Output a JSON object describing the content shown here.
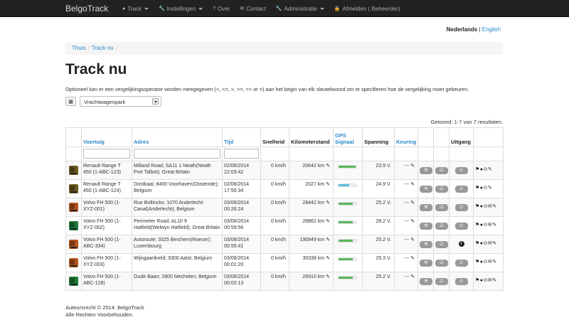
{
  "navbar": {
    "brand": "BelgoTrack",
    "items": [
      {
        "icon": "map-marker-icon",
        "glyph": "●",
        "label": "Track",
        "dropdown": true
      },
      {
        "icon": "wrench-icon",
        "glyph": "🔧",
        "label": "Instellingen",
        "dropdown": true
      },
      {
        "icon": "question-icon",
        "glyph": "?",
        "label": "Over",
        "dropdown": false
      },
      {
        "icon": "envelope-icon",
        "glyph": "✉",
        "label": "Contact",
        "dropdown": false
      },
      {
        "icon": "wrench-icon",
        "glyph": "🔧",
        "label": "Administratie",
        "dropdown": true
      },
      {
        "icon": "lock-icon",
        "glyph": "🔒",
        "label": "Afmelden ( Beheerder)",
        "dropdown": false
      }
    ]
  },
  "language": {
    "current": "Nederlands",
    "separator": "|",
    "other": "English"
  },
  "breadcrumb": [
    "Thuis",
    "Track nu"
  ],
  "page_title": "Track nu",
  "intro": "Optioneel kan er een vergelijkingsoperator worden meegegeven (<, <=, >, >=, <> or =) aan het begin van elk sleutelwoord om te specifieren hoe de vergelijking moet gebeuren.",
  "filter_select": {
    "value": "Vrachtwagenpark"
  },
  "result_count": "Getoond: 1-7 van 7 resultaten.",
  "table": {
    "headers": [
      "",
      "Voertuig",
      "Adres",
      "Tijd",
      "Snelheid",
      "Kilometerstand",
      "GPS Signaal",
      "Spanning",
      "Keuring",
      "",
      "",
      "Uitgang",
      ""
    ],
    "rows": [
      {
        "truck_color": "#6b5a1e",
        "vehicle": "Renault Range T 450 (1-ABC-123)",
        "address": "Milland Road; SA11 1 Neath(Neath Port Talbot); Great Britain",
        "time": "02/06/2014 22:03:42",
        "speed": "0 km/h",
        "km": "20642 km",
        "gps": 0.95,
        "gps_color": "#5cb85c",
        "voltage": "23.9 V.",
        "inspection": "---",
        "exit": "power",
        "actions": "⚑●⊙✎"
      },
      {
        "truck_color": "#6b5a1e",
        "vehicle": "Renault Range T 450 (1-ABC-124)",
        "address": "Oostkaai; 8400 Voorhaven(Oostende); Belgium",
        "time": "02/06/2014 17:50:34",
        "speed": "0 km/h",
        "km": "2027 km",
        "gps": 0.6,
        "gps_color": "#5bc0de",
        "voltage": "24.9 V.",
        "inspection": "---",
        "exit": "power",
        "actions": "⚑●⊙✎"
      },
      {
        "truck_color": "#b3541e",
        "vehicle": "Volvo FH 500 (1-XYZ-001)",
        "address": "Rue Bollinckx; 1070 Anderlecht-Canal(Anderlecht); Belgium",
        "time": "03/06/2014 00:26:24",
        "speed": "0 km/h",
        "km": "28442 km",
        "gps": 0.8,
        "gps_color": "#5cb85c",
        "voltage": "25.2 V.",
        "inspection": "---",
        "exit": "power",
        "actions": "⚑●⊙✉✎"
      },
      {
        "truck_color": "#1e7a3a",
        "vehicle": "Volvo FH 500 (1-XYZ-002)",
        "address": "Perimeter Road; AL10 9 Hatfield(Welwyn Hatfield); Great Britain",
        "time": "03/06/2014 00:59:56",
        "speed": "0 km/h",
        "km": "28862 km",
        "gps": 0.8,
        "gps_color": "#5cb85c",
        "voltage": "28.2 V.",
        "inspection": "---",
        "exit": "power",
        "actions": "⚑●⊙✉✎"
      },
      {
        "truck_color": "#b3541e",
        "vehicle": "Volvo FH 500 (1-ABC-334)",
        "address": "Autoroute; 3325 Berchem(Roeser); Luxembourg",
        "time": "03/06/2014 00:55:41",
        "speed": "0 km/h",
        "km": "190949 km",
        "gps": 0.8,
        "gps_color": "#5cb85c",
        "voltage": "25.2 V.",
        "inspection": "---",
        "exit": "info",
        "actions": "⚑●⊙✉✎"
      },
      {
        "truck_color": "#b3541e",
        "vehicle": "Volvo FH 500 (1-XYZ-003)",
        "address": "Wijngaardveld; 9300 Aalst; Belgium",
        "time": "03/06/2014 00:01:20",
        "speed": "0 km/h",
        "km": "30338 km",
        "gps": 0.8,
        "gps_color": "#5cb85c",
        "voltage": "25.3 V.",
        "inspection": "---",
        "exit": "power",
        "actions": "⚑●⊙✉✎"
      },
      {
        "truck_color": "#1e7a3a",
        "vehicle": "Volvo FH 500 (1-ABC-128)",
        "address": "Oude Baan; 2800 Mechelen; Belgium",
        "time": "03/06/2014 00:02:13",
        "speed": "0 km/h",
        "km": "26910 km",
        "gps": 0.8,
        "gps_color": "#5cb85c",
        "voltage": "25.2 V.",
        "inspection": "---",
        "exit": "power",
        "actions": "⚑●⊙✉✎"
      }
    ]
  },
  "footer": {
    "line1": "Auteursrecht © 2014: BelgoTrack",
    "line2": "Alle Rechten Voorbehouden."
  }
}
